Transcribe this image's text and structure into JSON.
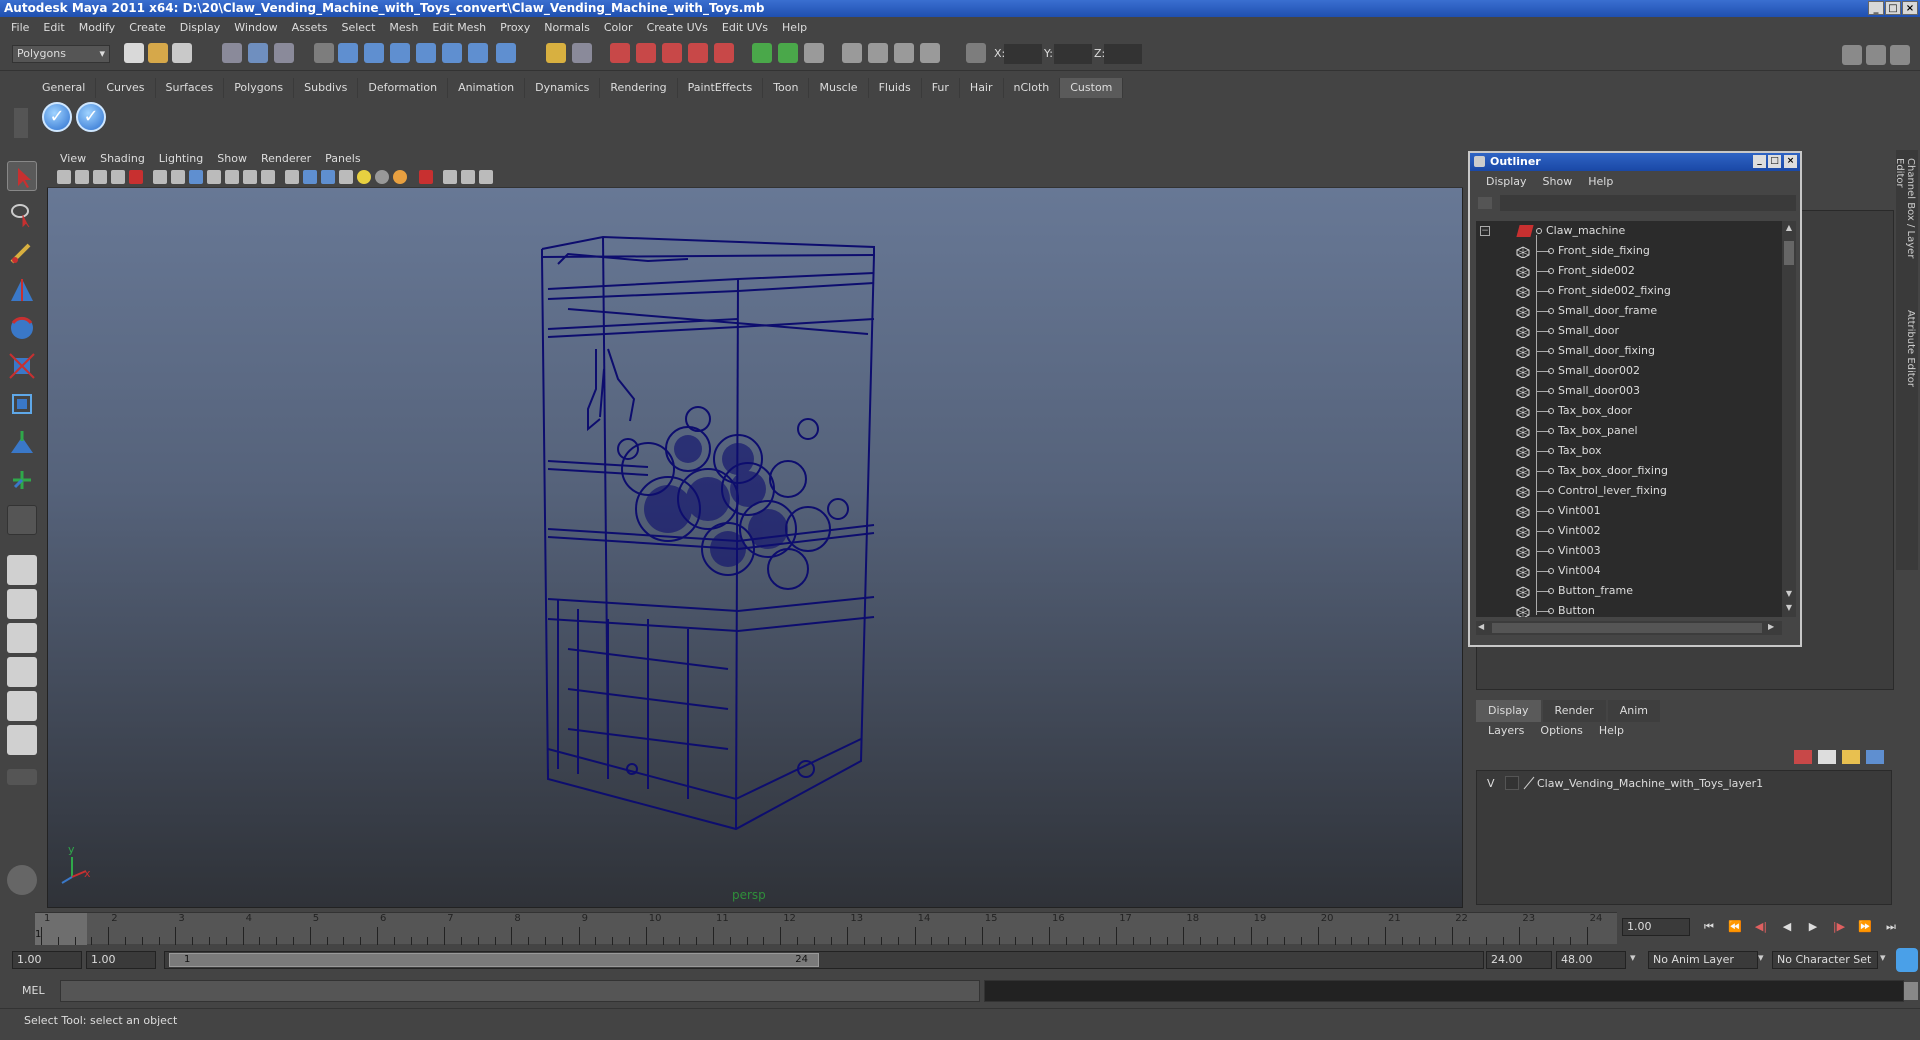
{
  "title": "Autodesk Maya 2011 x64: D:\\20\\Claw_Vending_Machine_with_Toys_convert\\Claw_Vending_Machine_with_Toys.mb",
  "window_controls": [
    "_",
    "□",
    "×"
  ],
  "menubar": [
    "File",
    "Edit",
    "Modify",
    "Create",
    "Display",
    "Window",
    "Assets",
    "Select",
    "Mesh",
    "Edit Mesh",
    "Proxy",
    "Normals",
    "Color",
    "Create UVs",
    "Edit UVs",
    "Help"
  ],
  "statusline": {
    "mode_dropdown": "Polygons",
    "x_label": "X:",
    "y_label": "Y:",
    "z_label": "Z:"
  },
  "shelf_tabs": [
    "General",
    "Curves",
    "Surfaces",
    "Polygons",
    "Subdivs",
    "Deformation",
    "Animation",
    "Dynamics",
    "Rendering",
    "PaintEffects",
    "Toon",
    "Muscle",
    "Fluids",
    "Fur",
    "Hair",
    "nCloth",
    "Custom"
  ],
  "active_shelf_tab": "Custom",
  "shelf_buttons": [
    "checkmark-icon",
    "checkmark-icon"
  ],
  "viewport": {
    "menu": [
      "View",
      "Shading",
      "Lighting",
      "Show",
      "Renderer",
      "Panels"
    ],
    "camera_label": "persp",
    "axis_x": "x",
    "axis_y": "y"
  },
  "outliner": {
    "title": "Outliner",
    "menu": [
      "Display",
      "Show",
      "Help"
    ],
    "root": "Claw_machine",
    "items": [
      "Front_side_fixing",
      "Front_side002",
      "Front_side002_fixing",
      "Small_door_frame",
      "Small_door",
      "Small_door_fixing",
      "Small_door002",
      "Small_door003",
      "Tax_box_door",
      "Tax_box_panel",
      "Tax_box",
      "Tax_box_door_fixing",
      "Control_lever_fixing",
      "Vint001",
      "Vint002",
      "Vint003",
      "Vint004",
      "Button_frame",
      "Button"
    ]
  },
  "layer_editor": {
    "tabs": [
      "Display",
      "Render",
      "Anim"
    ],
    "active_tab": "Display",
    "menu": [
      "Layers",
      "Options",
      "Help"
    ],
    "layer": {
      "visibility": "V",
      "name": "Claw_Vending_Machine_with_Toys_layer1"
    }
  },
  "side_tabs": [
    "Channel Box / Layer Editor",
    "Attribute Editor"
  ],
  "timeslider": {
    "ticks": [
      "1",
      "2",
      "3",
      "4",
      "5",
      "6",
      "7",
      "8",
      "9",
      "10",
      "11",
      "12",
      "13",
      "14",
      "15",
      "16",
      "17",
      "18",
      "19",
      "20",
      "21",
      "22",
      "23",
      "24"
    ],
    "current_frame_marker": "1",
    "current_frame": "1.00"
  },
  "playback": [
    "|◀◀",
    "|◀",
    "◀|",
    "◀",
    "▶",
    "▶|",
    "▶▶|",
    "▶|"
  ],
  "range": {
    "start_time": "1.00",
    "playback_start": "1.00",
    "slider_start": "1",
    "slider_end": "24",
    "playback_end": "24.00",
    "end_time": "48.00",
    "anim_layer": "No Anim Layer",
    "character_set": "No Character Set"
  },
  "command": {
    "label": "MEL"
  },
  "help_line": "Select Tool: select an object",
  "colors": {
    "wireframe": "#0d0d6e",
    "title_bar": "#1f4fb0",
    "viewport_top": "#6a7b99",
    "viewport_bottom": "#2f3238"
  }
}
